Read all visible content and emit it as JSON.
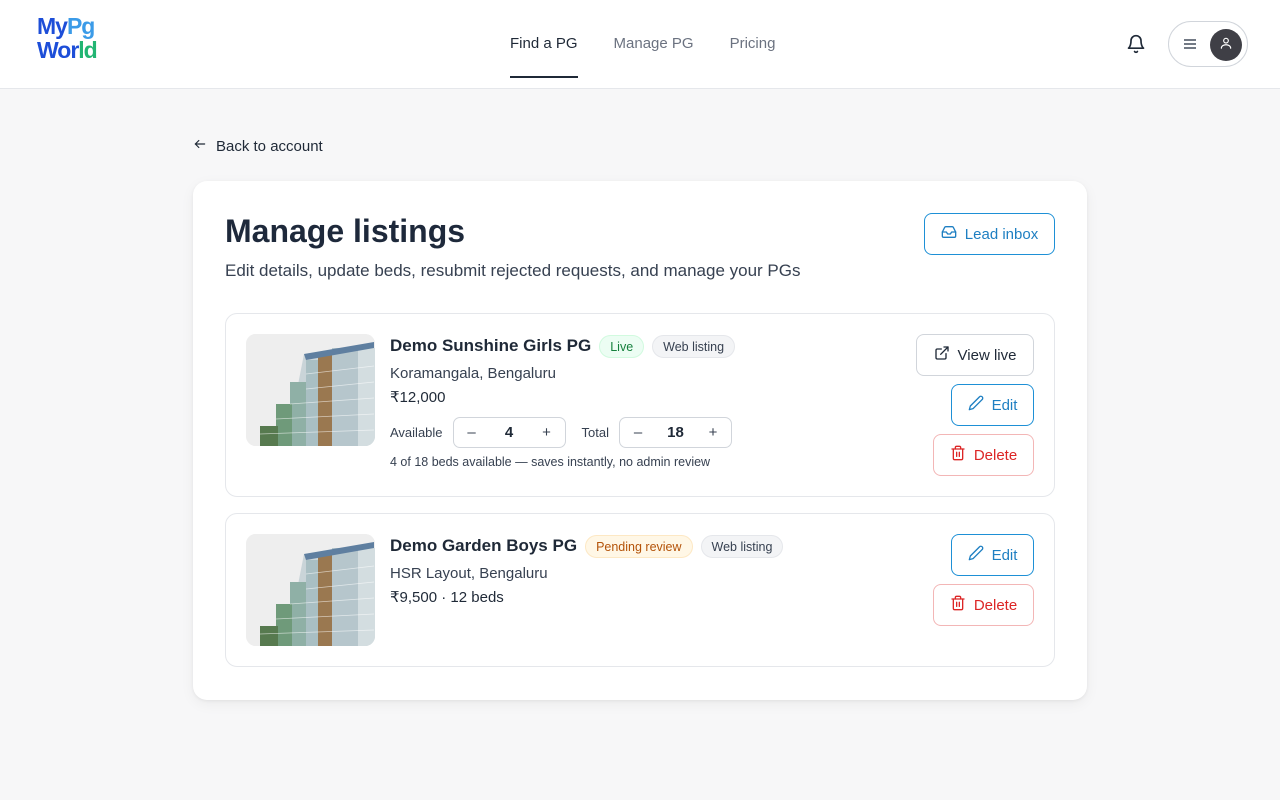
{
  "logo": {
    "line1a": "My",
    "line1b": "Pg",
    "line2a": "Wor",
    "line2b": "ld"
  },
  "nav": [
    {
      "label": "Find a PG",
      "active": true
    },
    {
      "label": "Manage PG",
      "active": false
    },
    {
      "label": "Pricing",
      "active": false
    }
  ],
  "header_icons": {
    "bell": "bell-icon",
    "menu": "menu-icon",
    "avatar": "user-icon"
  },
  "back": {
    "label": "Back to account"
  },
  "page": {
    "title": "Manage listings",
    "subtitle": "Edit details, update beds, resubmit rejected requests, and manage your PGs",
    "lead_inbox_label": "Lead inbox"
  },
  "listings": [
    {
      "name": "Demo Sunshine Girls PG",
      "status": "Live",
      "channel": "Web listing",
      "location": "Koramangala, Bengaluru",
      "price": "₹12,000",
      "available_label": "Available",
      "available": "4",
      "total_label": "Total",
      "total": "18",
      "minus": "–",
      "plus": "+",
      "note": "4 of 18 beds available — saves instantly, no admin review",
      "view_label": "View live",
      "edit_label": "Edit",
      "delete_label": "Delete"
    },
    {
      "name": "Demo Garden Boys PG",
      "status": "Pending review",
      "channel": "Web listing",
      "location": "HSR Layout, Bengaluru",
      "price": "₹9,500 · 12 beds",
      "edit_label": "Edit",
      "delete_label": "Delete"
    }
  ],
  "colors": {
    "accent": "#1e90d6",
    "danger": "#dc2626",
    "live": "#15803d",
    "pending": "#b45309"
  }
}
